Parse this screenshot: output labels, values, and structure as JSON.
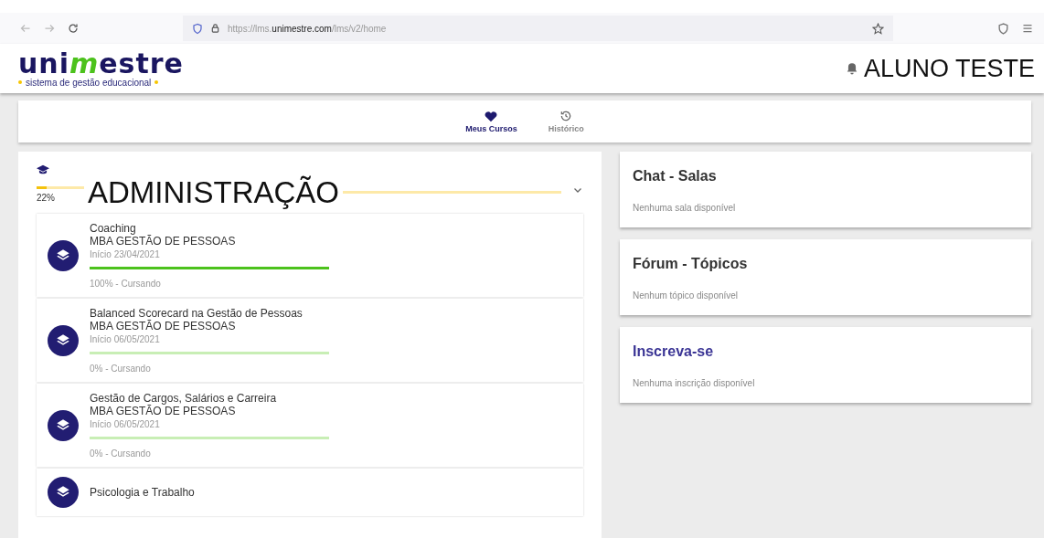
{
  "browser": {
    "url": "https://lms.**unimestre.com**/lms/v2/home"
  },
  "header": {
    "logo": {
      "start": "uni",
      "accent": "m",
      "end": "estre"
    },
    "tagline": "sistema de gestão educacional",
    "user": "ALUNO TESTE"
  },
  "nav": [
    {
      "label": "Meus Cursos",
      "selected": true,
      "kind": "heart"
    },
    {
      "label": "Histórico",
      "selected": false,
      "kind": "history"
    }
  ],
  "course_group": {
    "title": "ADMINISTRAÇÃO",
    "level": 0.22,
    "percent": "22%",
    "expanded": true,
    "courses": [
      {
        "title": "Coaching",
        "program": "MBA GESTÃO DE PESSOAS",
        "start": "Início 23/04/2021",
        "level": 1,
        "status": "100% - Cursando"
      },
      {
        "title": "Balanced Scorecard na Gestão de Pessoas",
        "program": "MBA GESTÃO DE PESSOAS",
        "start": "Início 06/05/2021",
        "level": 0,
        "status": "0% - Cursando"
      },
      {
        "title": "Gestão de Cargos, Salários e Carreira",
        "program": "MBA GESTÃO DE PESSOAS",
        "start": "Início 06/05/2021",
        "level": 0,
        "status": "0% - Cursando"
      },
      {
        "title": "Psicologia e Trabalho"
      }
    ]
  },
  "side_cards": [
    {
      "title": "Chat - Salas",
      "message": "Nenhuma sala disponível",
      "kind": "plain"
    },
    {
      "title": "Fórum - Tópicos",
      "message": "Nenhum tópico disponível",
      "kind": "plain"
    },
    {
      "title": "Inscreva-se",
      "message": "Nenhuma inscrição disponível",
      "kind": "accent"
    }
  ]
}
